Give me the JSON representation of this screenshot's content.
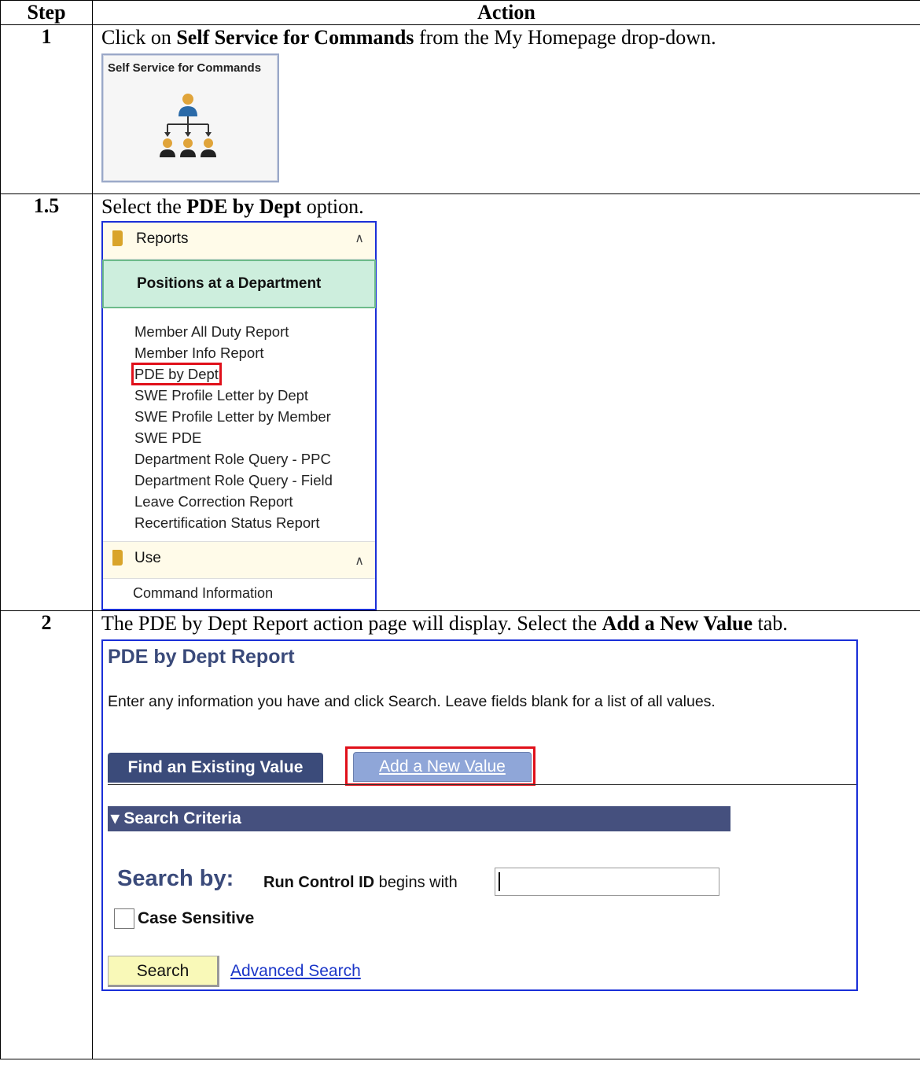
{
  "table": {
    "header_step": "Step",
    "header_action": "Action"
  },
  "rows": [
    {
      "step": "1",
      "text_pre": "Click on ",
      "text_bold": "Self Service for Commands",
      "text_post": " from the My Homepage drop-down.",
      "tile": {
        "title": "Self Service for Commands",
        "icon": "org-chart-icon"
      }
    },
    {
      "step": "1.5",
      "text_pre": "Select the ",
      "text_bold": "PDE by Dept",
      "text_post": " option.",
      "nav": {
        "section1": "Reports",
        "selected": "Positions at a Department",
        "items": [
          "Member All Duty Report",
          "Member Info Report",
          "PDE by Dept",
          "SWE Profile Letter by Dept",
          "SWE Profile Letter by Member",
          "SWE PDE",
          "Department Role Query - PPC",
          "Department Role Query - Field",
          "Leave Correction Report",
          "Recertification Status Report"
        ],
        "section2": "Use",
        "section2_item": "Command Information"
      }
    },
    {
      "step": "2",
      "text_pre": "The PDE by Dept Report action page will display.  Select the ",
      "text_bold": "Add a New Value",
      "text_post": " tab.",
      "page": {
        "title": "PDE by Dept Report",
        "instructions": "Enter any information you have and click Search. Leave fields blank for a list of all values.",
        "tab_find": "Find an Existing Value",
        "tab_add": "Add a New Value",
        "criteria": "▾ Search Criteria",
        "search_by": "Search by:",
        "field_label": "Run Control ID",
        "operator": "begins with",
        "field_value": "",
        "case_sensitive": "Case Sensitive",
        "search_button": "Search",
        "advanced_search": "Advanced Search"
      }
    }
  ]
}
